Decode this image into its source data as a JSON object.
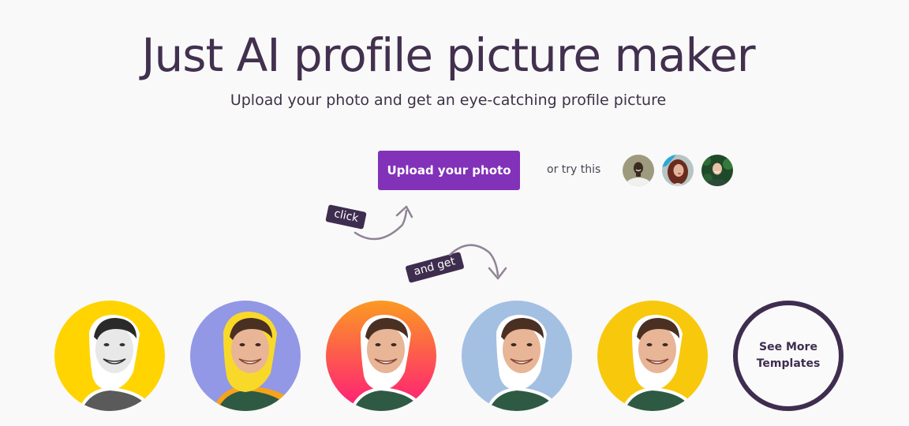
{
  "hero": {
    "title": "Just AI profile picture maker",
    "subtitle": "Upload your photo and get an eye-catching profile picture"
  },
  "actions": {
    "upload_label": "Upload your photo",
    "try_label": "or try this",
    "samples": [
      {
        "icon": "sample-photo-man-smiling"
      },
      {
        "icon": "sample-photo-woman-red-hair"
      },
      {
        "icon": "sample-photo-man-green-leaves"
      }
    ]
  },
  "annotations": {
    "click_label": "click",
    "and_get_label": "and get"
  },
  "templates": [
    {
      "name": "black-and-white-on-yellow",
      "background": "#ffd400",
      "style": "grayscale"
    },
    {
      "name": "yellow-outline-on-lavender",
      "background": "#9297e6",
      "style": "yellow-orange-outline"
    },
    {
      "name": "orange-pink-gradient",
      "background": "#ff3a73",
      "style": "gradient"
    },
    {
      "name": "light-blue",
      "background": "#a3c0e3",
      "style": "white-outline"
    },
    {
      "name": "yellow",
      "background": "#f8c80d",
      "style": "white-outline"
    }
  ],
  "see_more": {
    "line1": "See More",
    "line2": "Templates"
  },
  "colors": {
    "brand_purple": "#8132b8",
    "dark_plum": "#3f2d4f",
    "background": "#f9f9f9"
  }
}
